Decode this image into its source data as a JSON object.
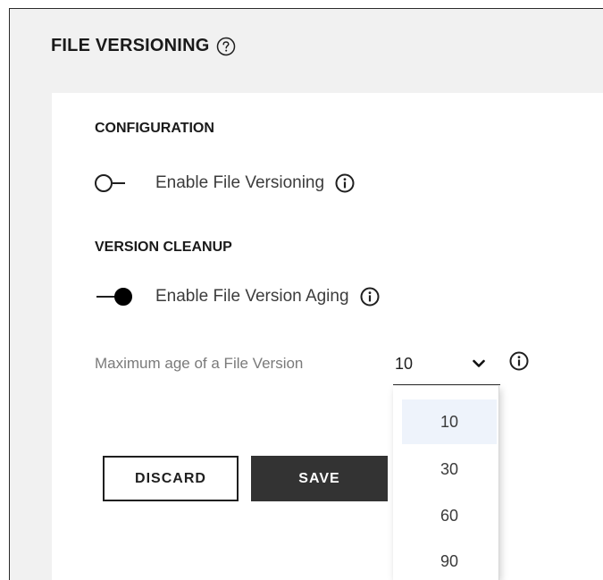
{
  "page": {
    "title": "FILE VERSIONING"
  },
  "configuration": {
    "heading": "CONFIGURATION",
    "toggle_label": "Enable File Versioning",
    "toggle_state": "off"
  },
  "cleanup": {
    "heading": "VERSION CLEANUP",
    "toggle_label": "Enable File Version Aging",
    "toggle_state": "on",
    "max_age_label": "Maximum age of a File Version",
    "max_age_value": "10",
    "options": [
      "10",
      "30",
      "60",
      "90"
    ],
    "selected_option": "10"
  },
  "actions": {
    "discard_label": "DISCARD",
    "save_label": "SAVE"
  },
  "colors": {
    "background": "#f1f1f1",
    "panel": "#ffffff",
    "save_button": "#333333",
    "option_highlight": "#eef3fb"
  },
  "icons": [
    "help-circle-icon",
    "info-icon",
    "chevron-down-icon"
  ]
}
